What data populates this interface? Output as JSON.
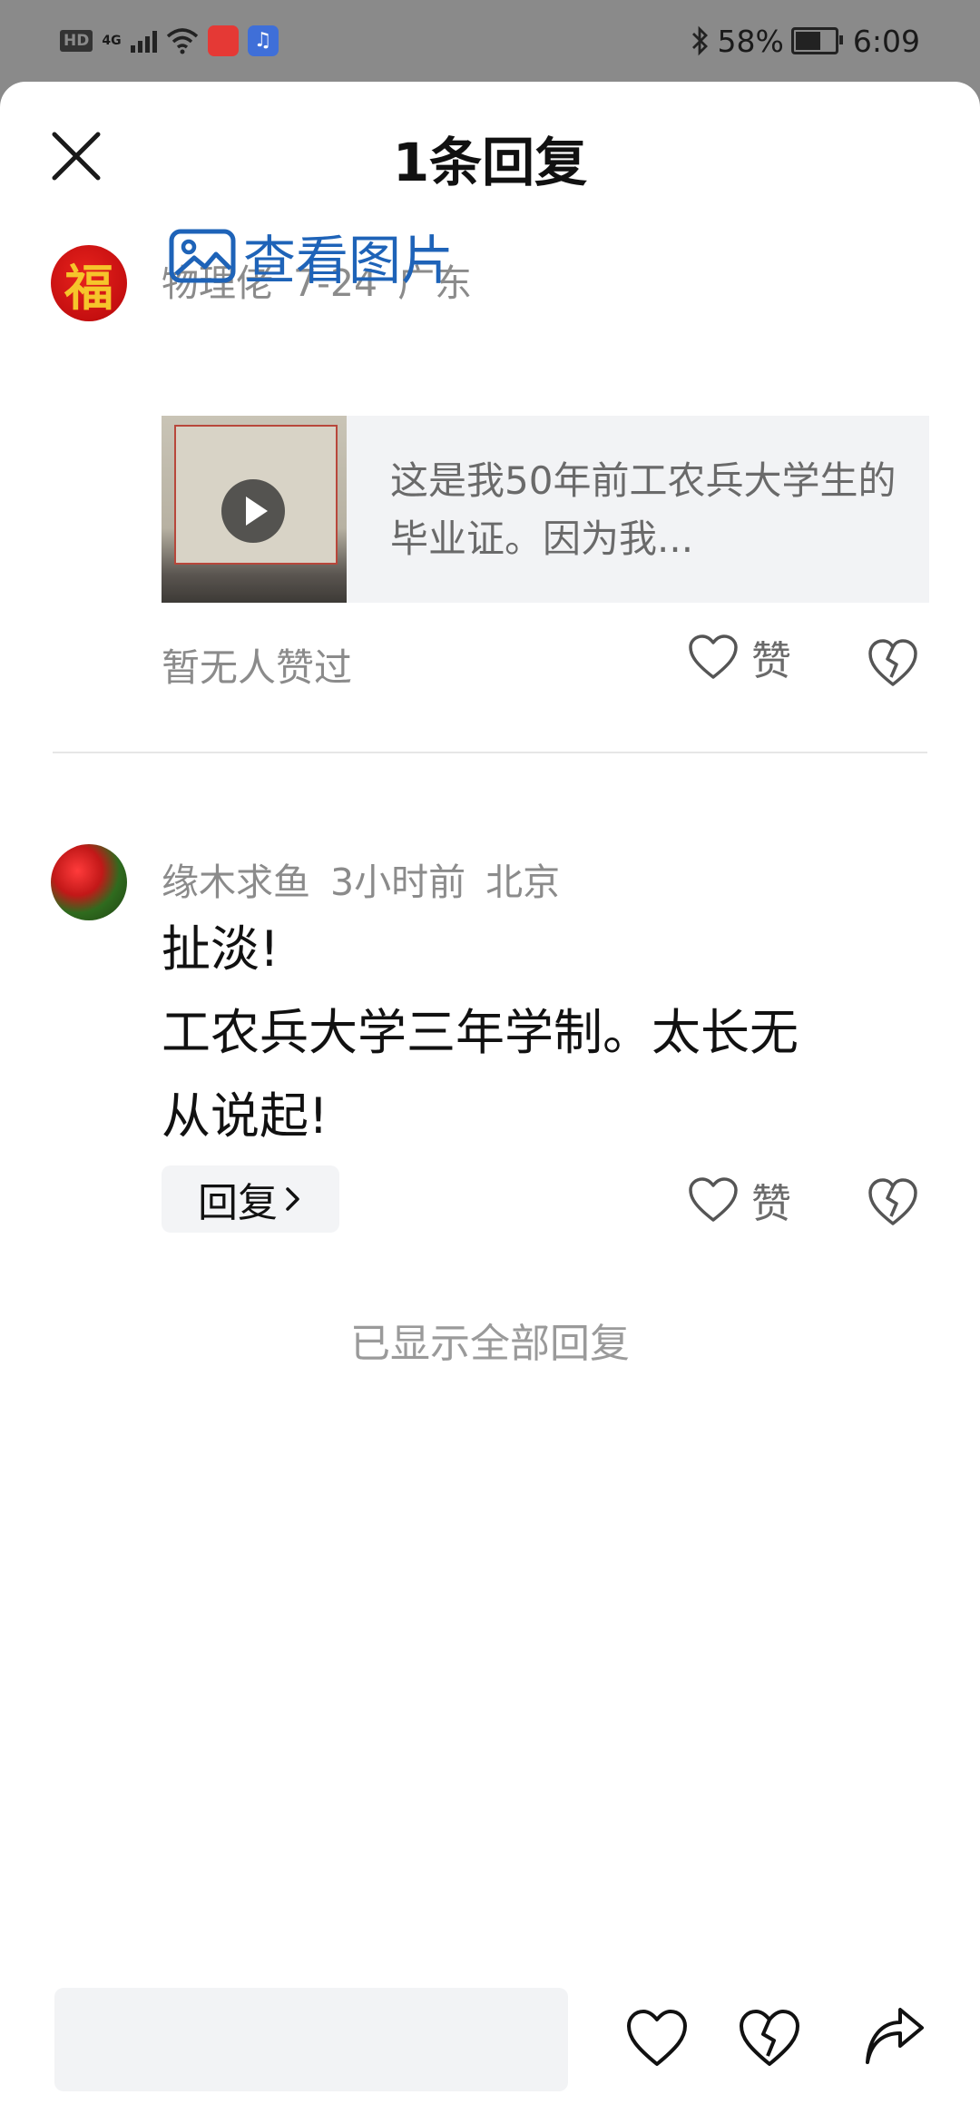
{
  "status_bar": {
    "hd": "HD",
    "network": "4G",
    "battery_pct": "58%",
    "battery_level": 0.58,
    "time": "6:09"
  },
  "header": {
    "title": "1条回复"
  },
  "main_comment": {
    "avatar_char": "福",
    "username": "物理佬",
    "date": "7-24",
    "location": "广东",
    "view_images_label": "查看图片",
    "quote_text": "这是我50年前工农兵大学生的毕业证。因为我...",
    "no_likes_text": "暂无人赞过",
    "like_label": "赞"
  },
  "reply": {
    "username": "缘木求鱼",
    "time": "3小时前",
    "location": "北京",
    "text_lines": [
      "扯淡!",
      "工农兵大学三年学制。太长无",
      "从说起!"
    ],
    "reply_button_label": "回复",
    "like_label": "赞"
  },
  "footer": {
    "all_shown_text": "已显示全部回复"
  },
  "icons": {
    "close": "close-icon",
    "image": "image-icon",
    "like": "heart-icon",
    "dislike": "broken-heart-icon",
    "share": "share-icon"
  },
  "colors": {
    "link_blue": "#1e63b8",
    "meta_gray": "#8b8b8b",
    "status_bar_bg": "#8a8a8a"
  }
}
